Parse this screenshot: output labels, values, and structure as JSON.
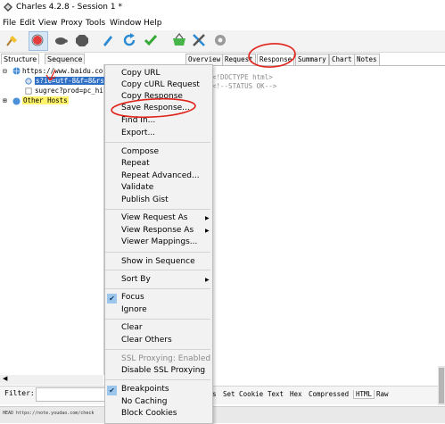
{
  "window": {
    "title": "Charles 4.2.8 - Session 1 *"
  },
  "menubar": {
    "items": [
      "File",
      "Edit",
      "View",
      "Proxy",
      "Tools",
      "Window",
      "Help"
    ]
  },
  "toolbar": {
    "icons": [
      "broom-icon",
      "record-icon",
      "turtle-icon",
      "breakpoint-icon",
      "pen-icon",
      "refresh-icon",
      "check-icon",
      "basket-icon",
      "tools-icon",
      "settings-icon"
    ],
    "colors": {
      "record": "#e43d3d",
      "refresh": "#2a8bd4",
      "check": "#35a935",
      "basket": "#47b54a"
    }
  },
  "left_tabs": [
    "Structure",
    "Sequence"
  ],
  "tree": {
    "root": "https://www.baidu.co",
    "selected": "s?ie=utf-8&f=8&rs",
    "child2": "sugrec?prod=pc_hi",
    "other": "Other Hosts"
  },
  "right_tabs": [
    "Overview",
    "Request",
    "Response",
    "Summary",
    "Chart",
    "Notes"
  ],
  "response_body": {
    "line1": "<!DOCTYPE html>",
    "line2": "<!--STATUS OK-->"
  },
  "context_menu": {
    "copy_url": "Copy URL",
    "copy_curl": "Copy cURL Request",
    "copy_response": "Copy Response",
    "save_response": "Save Response...",
    "find_in": "Find In...",
    "export": "Export...",
    "compose": "Compose",
    "repeat": "Repeat",
    "repeat_advanced": "Repeat Advanced...",
    "validate": "Validate",
    "publish_gist": "Publish Gist",
    "view_request_as": "View Request As",
    "view_response_as": "View Response As",
    "viewer_mappings": "Viewer Mappings...",
    "show_in_sequence": "Show in Sequence",
    "sort_by": "Sort By",
    "focus": "Focus",
    "ignore": "Ignore",
    "clear": "Clear",
    "clear_others": "Clear Others",
    "ssl_proxying_enabled": "SSL Proxying: Enabled",
    "disable_ssl": "Disable SSL Proxying",
    "breakpoints": "Breakpoints",
    "no_caching": "No Caching",
    "block_cookies": "Block Cookies"
  },
  "filter": {
    "label": "Filter:",
    "value": ""
  },
  "bottom_tabs": [
    "s",
    "Set Cookie",
    "Text",
    "Hex",
    "Compressed",
    "HTML",
    "Raw"
  ],
  "status": {
    "text": "HEAD https://note.youdao.com/check"
  },
  "annotation_color": "#e0241b"
}
